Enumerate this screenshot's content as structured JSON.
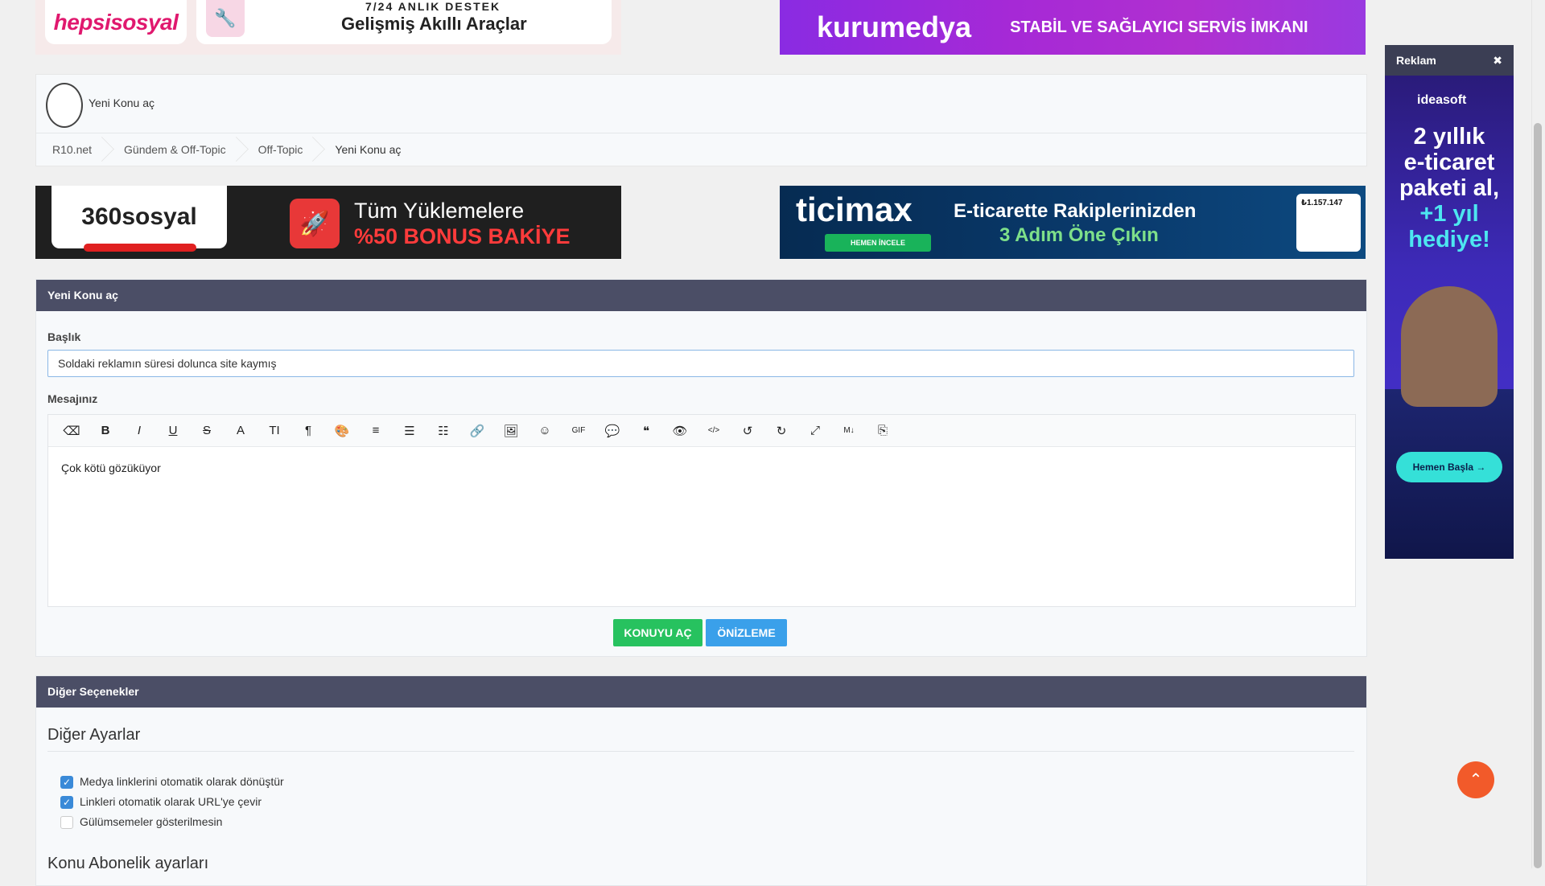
{
  "ads": {
    "top_left_brand": "hepsisosyal",
    "top_left_line1": "7/24 ANLIK DESTEK",
    "top_left_line2": "Gelişmiş Akıllı Araçlar",
    "top_right_brand": "kurumedya",
    "top_right_tagline": "STABİL VE SAĞLAYICI SERVİS İMKANI",
    "mid_left_brand": "360sosyal",
    "mid_left_line1": "Tüm Yüklemelere",
    "mid_left_line2": "%50 BONUS BAKİYE",
    "mid_right_brand": "ticimax",
    "mid_right_button": "HEMEN İNCELE",
    "mid_right_line1": "E-ticarette Rakiplerinizden",
    "mid_right_line2": "3 Adım Öne Çıkın",
    "mid_right_card_value": "₺1.157.147",
    "side_header": "Reklam",
    "side_brand": "ideasoft",
    "side_line1": "2 yıllık",
    "side_line2": "e-ticaret",
    "side_line3": "paketi al,",
    "side_line4": "+1 yıl",
    "side_line5": "hediye!",
    "side_cta": "Hemen Başla →"
  },
  "header": {
    "page_title": "Yeni Konu aç"
  },
  "breadcrumb": [
    {
      "label": "R10.net"
    },
    {
      "label": "Gündem & Off-Topic"
    },
    {
      "label": "Off-Topic"
    },
    {
      "label": "Yeni Konu aç"
    }
  ],
  "form": {
    "panel_title": "Yeni Konu aç",
    "title_label": "Başlık",
    "title_value": "Soldaki reklamın süresi dolunca site kaymış",
    "message_label": "Mesajınız",
    "message_value": "Çok kötü gözüküyor",
    "submit_label": "KONUYU AÇ",
    "preview_label": "ÖNİZLEME"
  },
  "toolbar": [
    {
      "name": "eraser-icon",
      "glyph": "⌫"
    },
    {
      "name": "bold-icon",
      "glyph": "B"
    },
    {
      "name": "italic-icon",
      "glyph": "I"
    },
    {
      "name": "underline-icon",
      "glyph": "U"
    },
    {
      "name": "strikethrough-icon",
      "glyph": "S"
    },
    {
      "name": "font-color-icon",
      "glyph": "A"
    },
    {
      "name": "font-size-icon",
      "glyph": "TI"
    },
    {
      "name": "paragraph-icon",
      "glyph": "¶"
    },
    {
      "name": "palette-icon",
      "glyph": "🎨"
    },
    {
      "name": "align-icon",
      "glyph": "≡"
    },
    {
      "name": "bullet-list-icon",
      "glyph": "☰"
    },
    {
      "name": "numbered-list-icon",
      "glyph": "☷"
    },
    {
      "name": "link-icon",
      "glyph": "🔗"
    },
    {
      "name": "image-icon",
      "glyph": "🖼"
    },
    {
      "name": "emoji-icon",
      "glyph": "☺"
    },
    {
      "name": "gif-icon",
      "glyph": "GIF"
    },
    {
      "name": "comment-icon",
      "glyph": "💬"
    },
    {
      "name": "quote-icon",
      "glyph": "❝"
    },
    {
      "name": "hide-icon",
      "glyph": "👁"
    },
    {
      "name": "code-icon",
      "glyph": "</>"
    },
    {
      "name": "undo-icon",
      "glyph": "↺"
    },
    {
      "name": "redo-icon",
      "glyph": "↻"
    },
    {
      "name": "fullscreen-icon",
      "glyph": "⤢"
    },
    {
      "name": "markdown-icon",
      "glyph": "M↓"
    },
    {
      "name": "source-icon",
      "glyph": "⎘"
    }
  ],
  "options": {
    "panel_title": "Diğer Seçenekler",
    "section_title": "Diğer Ayarlar",
    "checkboxes": [
      {
        "label": "Medya linklerini otomatik olarak dönüştür",
        "checked": true
      },
      {
        "label": "Linkleri otomatik olarak URL'ye çevir",
        "checked": true
      },
      {
        "label": "Gülümsemeler gösterilmesin",
        "checked": false
      }
    ],
    "section2_title": "Konu Abonelik ayarları"
  },
  "colors": {
    "panel_header": "#4b4e66",
    "submit": "#27c25f",
    "preview": "#3aa0ea",
    "to_top": "#f25a2a"
  }
}
